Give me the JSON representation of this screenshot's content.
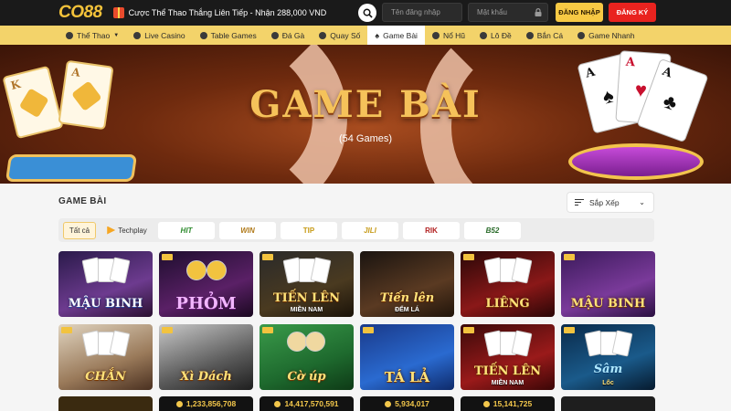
{
  "header": {
    "logo": "CO88",
    "promo": "Cược Thể Thao Thắng Liên Tiếp - Nhận 288,000 VND",
    "username_placeholder": "Tên đăng nhập",
    "password_placeholder": "Mật khẩu",
    "login_label": "ĐĂNG NHẬP",
    "register_label": "ĐĂNG KÝ"
  },
  "nav": {
    "items": [
      {
        "label": "Thể Thao",
        "icon": "soccer-ball-icon"
      },
      {
        "label": "Live Casino",
        "icon": "casino-icon"
      },
      {
        "label": "Table Games",
        "icon": "roulette-icon"
      },
      {
        "label": "Đá Gà",
        "icon": "rooster-icon"
      },
      {
        "label": "Quay Số",
        "icon": "lottery-icon"
      },
      {
        "label": "Game Bài",
        "icon": "spade-icon"
      },
      {
        "label": "Nổ Hũ",
        "icon": "slot-icon"
      },
      {
        "label": "Lô Đề",
        "icon": "ticket-icon"
      },
      {
        "label": "Bắn Cá",
        "icon": "target-icon"
      },
      {
        "label": "Game Nhanh",
        "icon": "rocket-icon"
      }
    ],
    "active": "Game Bài"
  },
  "banner": {
    "title": "GAME BÀI",
    "subtitle": "(54 Games)",
    "left_cards": [
      "K",
      "A"
    ],
    "right_cards": [
      "A",
      "A",
      "A"
    ]
  },
  "section": {
    "title": "GAME BÀI",
    "sort_label": "Sắp Xếp"
  },
  "filters": [
    "Tất cả",
    "Techplay",
    "HIT",
    "WIN",
    "TIP",
    "JILI",
    "RIK",
    "B52"
  ],
  "games": [
    {
      "title": "MẬU BINH",
      "subtitle": ""
    },
    {
      "title": "PHỎM",
      "subtitle": ""
    },
    {
      "title": "TIẾN LÊN",
      "subtitle": "MIỀN NAM"
    },
    {
      "title": "Tiến lên",
      "subtitle": "ĐẾM LÁ"
    },
    {
      "title": "LIÊNG",
      "subtitle": ""
    },
    {
      "title": "MẬU BINH",
      "subtitle": ""
    },
    {
      "title": "CHẮN",
      "subtitle": ""
    },
    {
      "title": "Xì Dách",
      "subtitle": ""
    },
    {
      "title": "Cờ úp",
      "subtitle": ""
    },
    {
      "title": "TÁ LẢ",
      "subtitle": ""
    },
    {
      "title": "TIẾN LÊN",
      "subtitle": "MIỀN NAM"
    },
    {
      "title": "Sâm",
      "subtitle": "Lốc"
    }
  ],
  "jackpots": [
    "",
    "1,233,856,708",
    "14,417,570,591",
    "5,934,017",
    "15,141,725",
    ""
  ],
  "colors": {
    "topbar": "#1a1a1a",
    "nav": "#f3d36a",
    "login": "#f7c944",
    "register": "#e9231f",
    "gold": "#f5c25a"
  }
}
